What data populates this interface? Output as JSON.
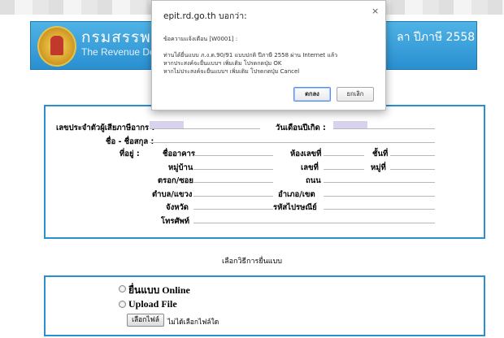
{
  "banner": {
    "title_th": "กรมสรรพาก",
    "title_en": "The Revenue Depar",
    "title_right": "ลา ปีภาษี 2558"
  },
  "dialog": {
    "title": "epit.rd.go.th บอกว่า:",
    "close": "×",
    "messages": [
      "ข้อความแจ้งเตือน [W0001] :",
      "ท่านได้ยื่นแบบ ภ.ง.ด.90/91 แบบปกติ ปีภาษี 2558 ผ่าน Internet แล้ว",
      "หากประสงค์จะยื่นแบบฯ เพิ่มเติม โปรดกดปุ่ม OK",
      "หากไม่ประสงค์จะยื่นแบบฯ เพิ่มเติม โปรดกดปุ่ม Cancel"
    ],
    "ok_label": "ตกลง",
    "cancel_label": "ยกเลิก"
  },
  "form": {
    "tax_id": "เลขประจำตัวผู้เสียภาษีอากร :",
    "birth_date": "วันเดือนปีเกิด :",
    "name": "ชื่อ - ชื่อสกุล :",
    "address": "ที่อยู่ :",
    "building": "ชื่ออาคาร",
    "room_no": "ห้องเลขที่",
    "floor": "ชั้นที่",
    "village": "หมู่บ้าน",
    "house_no": "เลขที่",
    "moo": "หมู่ที่",
    "soi": "ตรอก/ซอย",
    "road": "ถนน",
    "subdistrict": "ตำบล/แขวง",
    "district": "อำเภอ/เขต",
    "province": "จังหวัด",
    "postcode": "รหัสไปรษณีย์",
    "phone": "โทรศัพท์"
  },
  "filing": {
    "title": "เลือกวิธีการยื่นแบบ",
    "option_online": "ยื่นแบบ Online",
    "option_upload": "Upload File",
    "choose_file": "เลือกไฟล์",
    "no_file": "ไม่ได้เลือกไฟล์ใด"
  }
}
